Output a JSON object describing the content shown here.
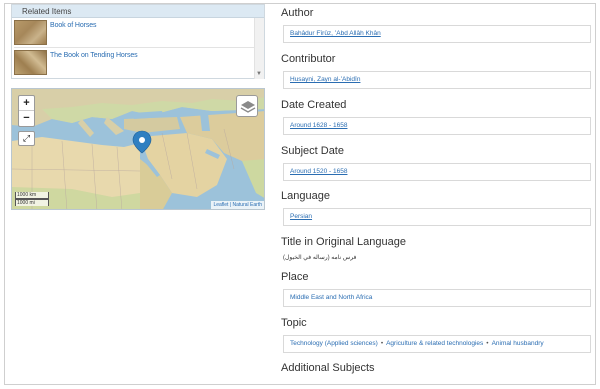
{
  "related": {
    "header": "Related Items",
    "items": [
      {
        "label": "Book of Horses"
      },
      {
        "label": "The Book on Tending Horses"
      }
    ]
  },
  "map": {
    "zoom_in": "+",
    "zoom_out": "−",
    "scale_km": "1000 km",
    "scale_mi": "1000 mi",
    "attribution": "Leaflet | Natural Earth",
    "marker_color": "#2f7fc1"
  },
  "fields": {
    "author": {
      "label": "Author",
      "value": "Bahâdur Fîrûz, ʻAbd Allâh Khân"
    },
    "contributor": {
      "label": "Contributor",
      "value": "Husayni, Zayn al-ʻAbidîn"
    },
    "date_created": {
      "label": "Date Created",
      "value": "Around 1628 - 1658"
    },
    "subject_date": {
      "label": "Subject Date",
      "value": "Around 1520 - 1658"
    },
    "language": {
      "label": "Language",
      "value": "Persian"
    },
    "title_original": {
      "label": "Title in Original Language",
      "value": "فرس نامه (رساله في الخيول)"
    },
    "place": {
      "label": "Place",
      "value": "Middle East and North Africa"
    },
    "topic": {
      "label": "Topic",
      "values": [
        "Technology (Applied sciences)",
        "Agriculture & related technologies",
        "Animal husbandry"
      ],
      "separator": "•"
    },
    "additional_subjects": {
      "label": "Additional Subjects"
    }
  }
}
